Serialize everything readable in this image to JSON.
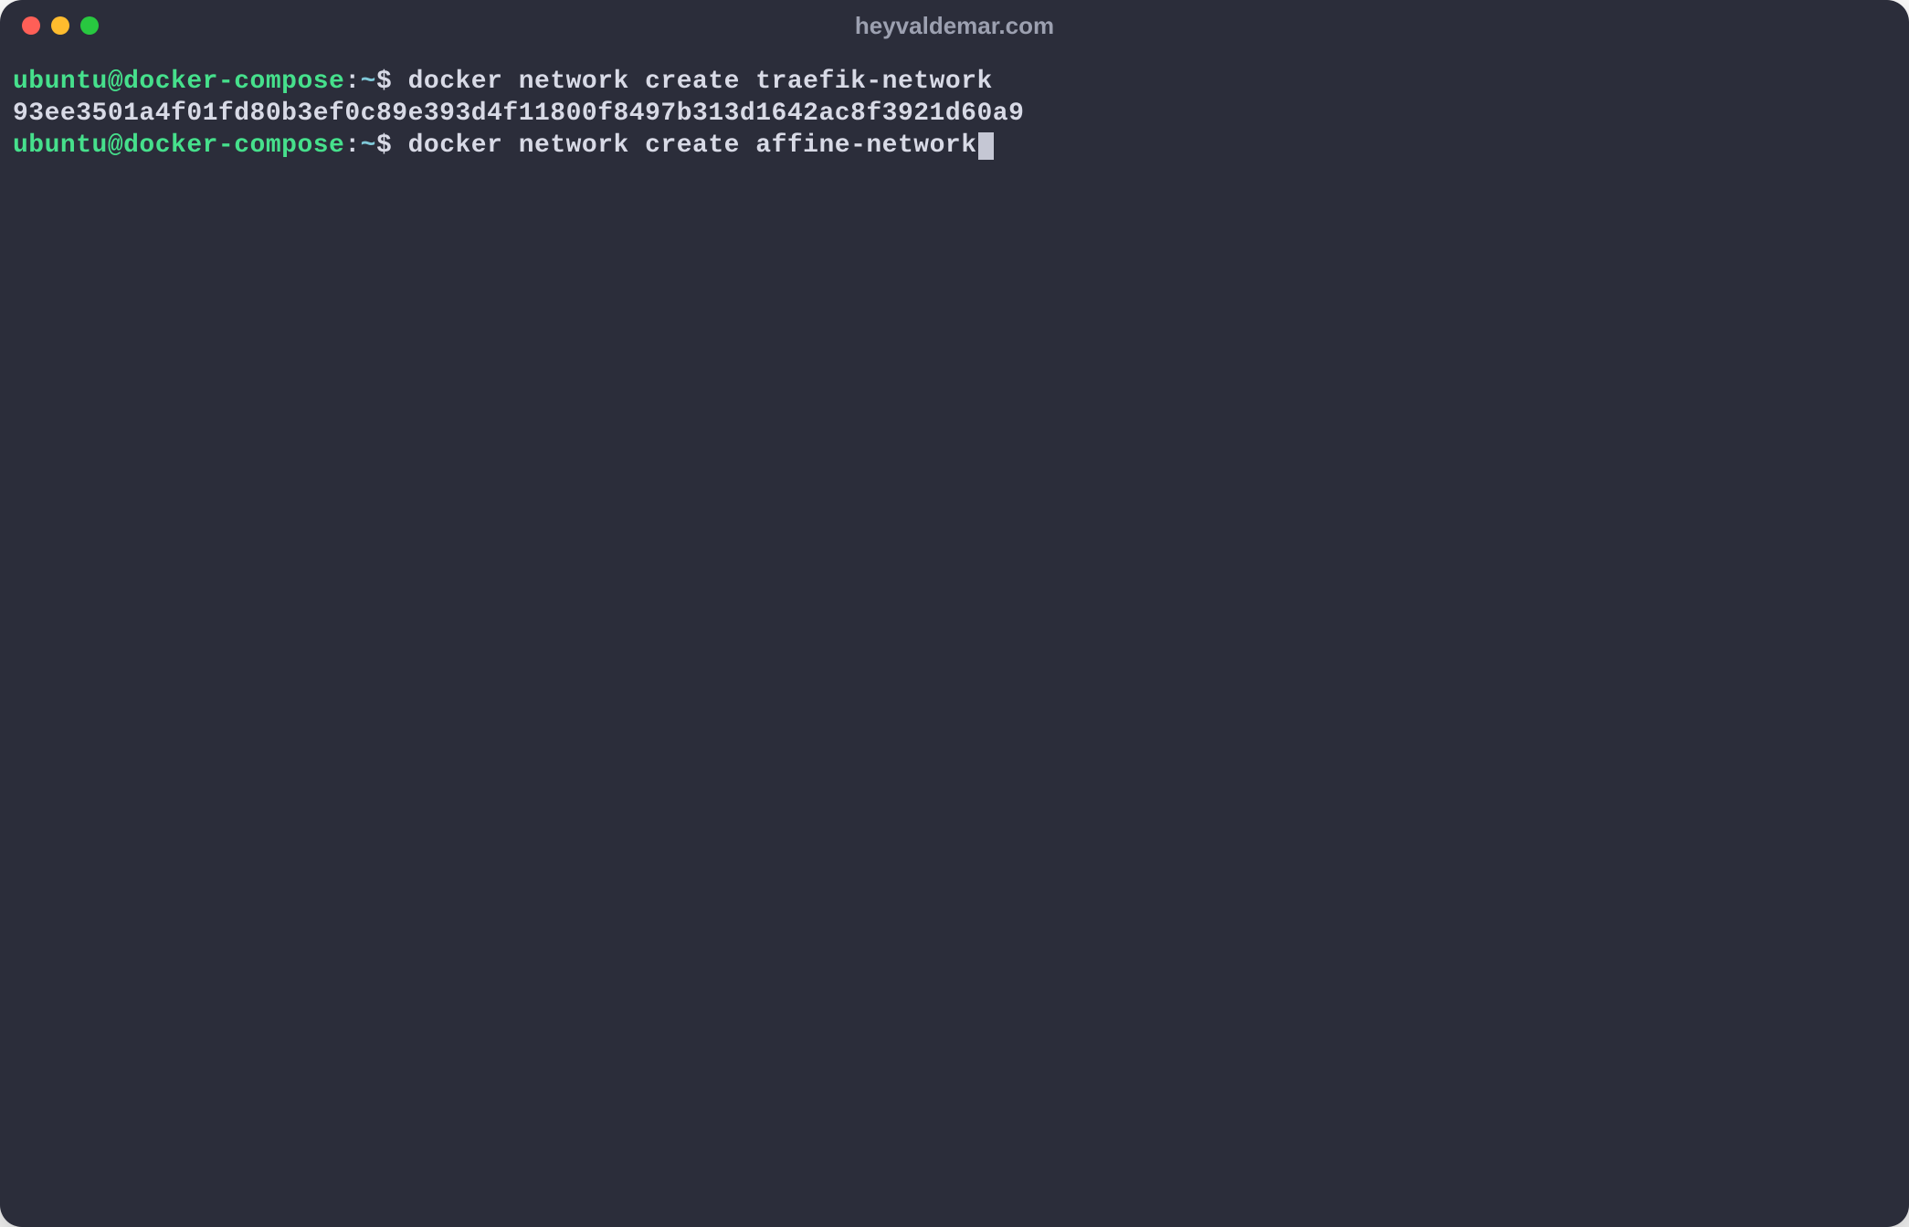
{
  "window": {
    "title": "heyvaldemar.com"
  },
  "terminal": {
    "lines": [
      {
        "user_host": "ubuntu@docker-compose",
        "colon": ":",
        "path": "~",
        "dollar": "$",
        "command": " docker network create traefik-network"
      },
      {
        "output": "93ee3501a4f01fd80b3ef0c89e393d4f11800f8497b313d1642ac8f3921d60a9"
      },
      {
        "user_host": "ubuntu@docker-compose",
        "colon": ":",
        "path": "~",
        "dollar": "$",
        "command": " docker network create affine-network"
      }
    ]
  }
}
